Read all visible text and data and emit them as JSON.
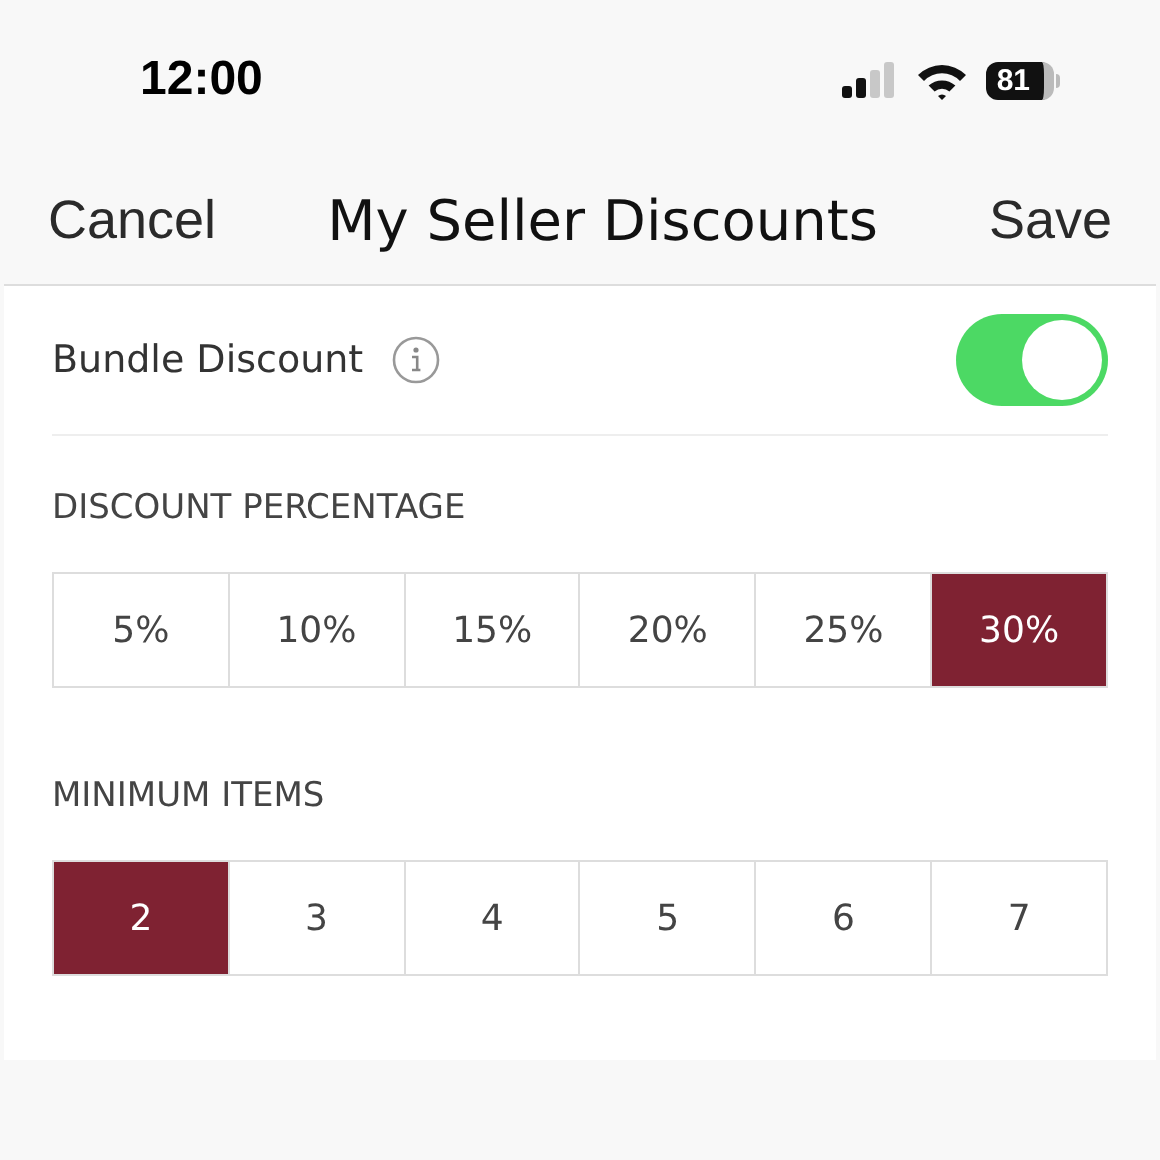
{
  "status_bar": {
    "time": "12:00",
    "battery": "81"
  },
  "nav": {
    "cancel": "Cancel",
    "title": "My Seller Discounts",
    "save": "Save"
  },
  "bundle": {
    "label": "Bundle Discount",
    "on": true
  },
  "percentage": {
    "heading": "DISCOUNT PERCENTAGE",
    "options": [
      {
        "label": "5%",
        "selected": false
      },
      {
        "label": "10%",
        "selected": false
      },
      {
        "label": "15%",
        "selected": false
      },
      {
        "label": "20%",
        "selected": false
      },
      {
        "label": "25%",
        "selected": false
      },
      {
        "label": "30%",
        "selected": true
      }
    ]
  },
  "minimum": {
    "heading": "MINIMUM ITEMS",
    "options": [
      {
        "label": "2",
        "selected": true
      },
      {
        "label": "3",
        "selected": false
      },
      {
        "label": "4",
        "selected": false
      },
      {
        "label": "5",
        "selected": false
      },
      {
        "label": "6",
        "selected": false
      },
      {
        "label": "7",
        "selected": false
      }
    ]
  }
}
